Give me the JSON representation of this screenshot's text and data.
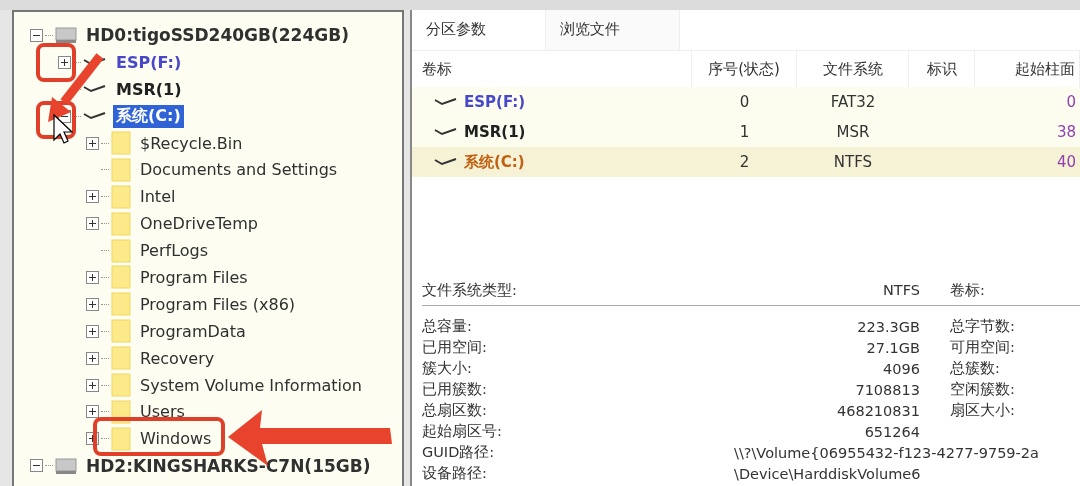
{
  "tree": [
    {
      "label": "HD0:tigoSSD240GB(224GB)",
      "kind": "disk",
      "expanded": true,
      "selected": false,
      "children": [
        {
          "label": "ESP(F:)",
          "kind": "partition",
          "expandable": true,
          "expanded": false,
          "selected": false,
          "color": "#4848c8"
        },
        {
          "label": "MSR(1)",
          "kind": "partition",
          "expandable": false,
          "selected": false,
          "color": "#202020"
        },
        {
          "label": "系统(C:)",
          "kind": "partition",
          "expanded": true,
          "selected": true,
          "children": [
            {
              "label": "$Recycle.Bin",
              "kind": "folder",
              "expandable": true,
              "selected": false
            },
            {
              "label": "Documents and Settings",
              "kind": "folder",
              "expandable": false,
              "selected": false
            },
            {
              "label": "Intel",
              "kind": "folder",
              "expandable": true,
              "selected": false
            },
            {
              "label": "OneDriveTemp",
              "kind": "folder",
              "expandable": true,
              "selected": false
            },
            {
              "label": "PerfLogs",
              "kind": "folder",
              "expandable": false,
              "selected": false
            },
            {
              "label": "Program Files",
              "kind": "folder",
              "expandable": true,
              "selected": false
            },
            {
              "label": "Program Files (x86)",
              "kind": "folder",
              "expandable": true,
              "selected": false
            },
            {
              "label": "ProgramData",
              "kind": "folder",
              "expandable": true,
              "selected": false
            },
            {
              "label": "Recovery",
              "kind": "folder",
              "expandable": true,
              "selected": false
            },
            {
              "label": "System Volume Information",
              "kind": "folder",
              "expandable": true,
              "selected": false
            },
            {
              "label": "Users",
              "kind": "folder",
              "expandable": true,
              "selected": false
            },
            {
              "label": "Windows",
              "kind": "folder",
              "expandable": true,
              "selected": false
            }
          ]
        }
      ]
    },
    {
      "label": "HD2:KINGSHARKS-C7N(15GB)",
      "kind": "disk",
      "expanded": true,
      "selected": false
    }
  ],
  "tabs": [
    {
      "label": "分区参数",
      "selected": true
    },
    {
      "label": "浏览文件",
      "selected": false
    }
  ],
  "table": {
    "columns": [
      "卷标",
      "序号(状态)",
      "文件系统",
      "标识",
      "起始柱面"
    ],
    "rows": [
      {
        "name": "ESP(F:)",
        "color": "#4848c8",
        "index": "0",
        "fs": "FAT32",
        "start": "0",
        "selected": false
      },
      {
        "name": "MSR(1)",
        "color": "#202020",
        "index": "1",
        "fs": "MSR",
        "start": "38",
        "selected": false
      },
      {
        "name": "系统(C:)",
        "color": "#c06010",
        "index": "2",
        "fs": "NTFS",
        "start": "40",
        "selected": true
      }
    ]
  },
  "info": {
    "header": {
      "label": "文件系统类型:",
      "value": "NTFS",
      "label2": "卷标:"
    },
    "rows": [
      {
        "kind": "pair",
        "label": "总容量:",
        "value": "223.3GB",
        "label2": "总字节数:"
      },
      {
        "kind": "pair",
        "label": "已用空间:",
        "value": "27.1GB",
        "label2": "可用空间:"
      },
      {
        "kind": "pair",
        "label": "簇大小:",
        "value": "4096",
        "label2": "总簇数:"
      },
      {
        "kind": "pair",
        "label": "已用簇数:",
        "value": "7108813",
        "label2": "空闲簇数:"
      },
      {
        "kind": "pair",
        "label": "总扇区数:",
        "value": "468210831",
        "label2": "扇区大小:"
      },
      {
        "kind": "pair",
        "label": "起始扇区号:",
        "value": "651264"
      },
      {
        "kind": "path",
        "label": "GUID路径:",
        "value": "\\\\?\\Volume{06955432-f123-4277-9759-2a"
      },
      {
        "kind": "path",
        "label": "设备路径:",
        "value": "\\Device\\HarddiskVolume6"
      }
    ]
  }
}
